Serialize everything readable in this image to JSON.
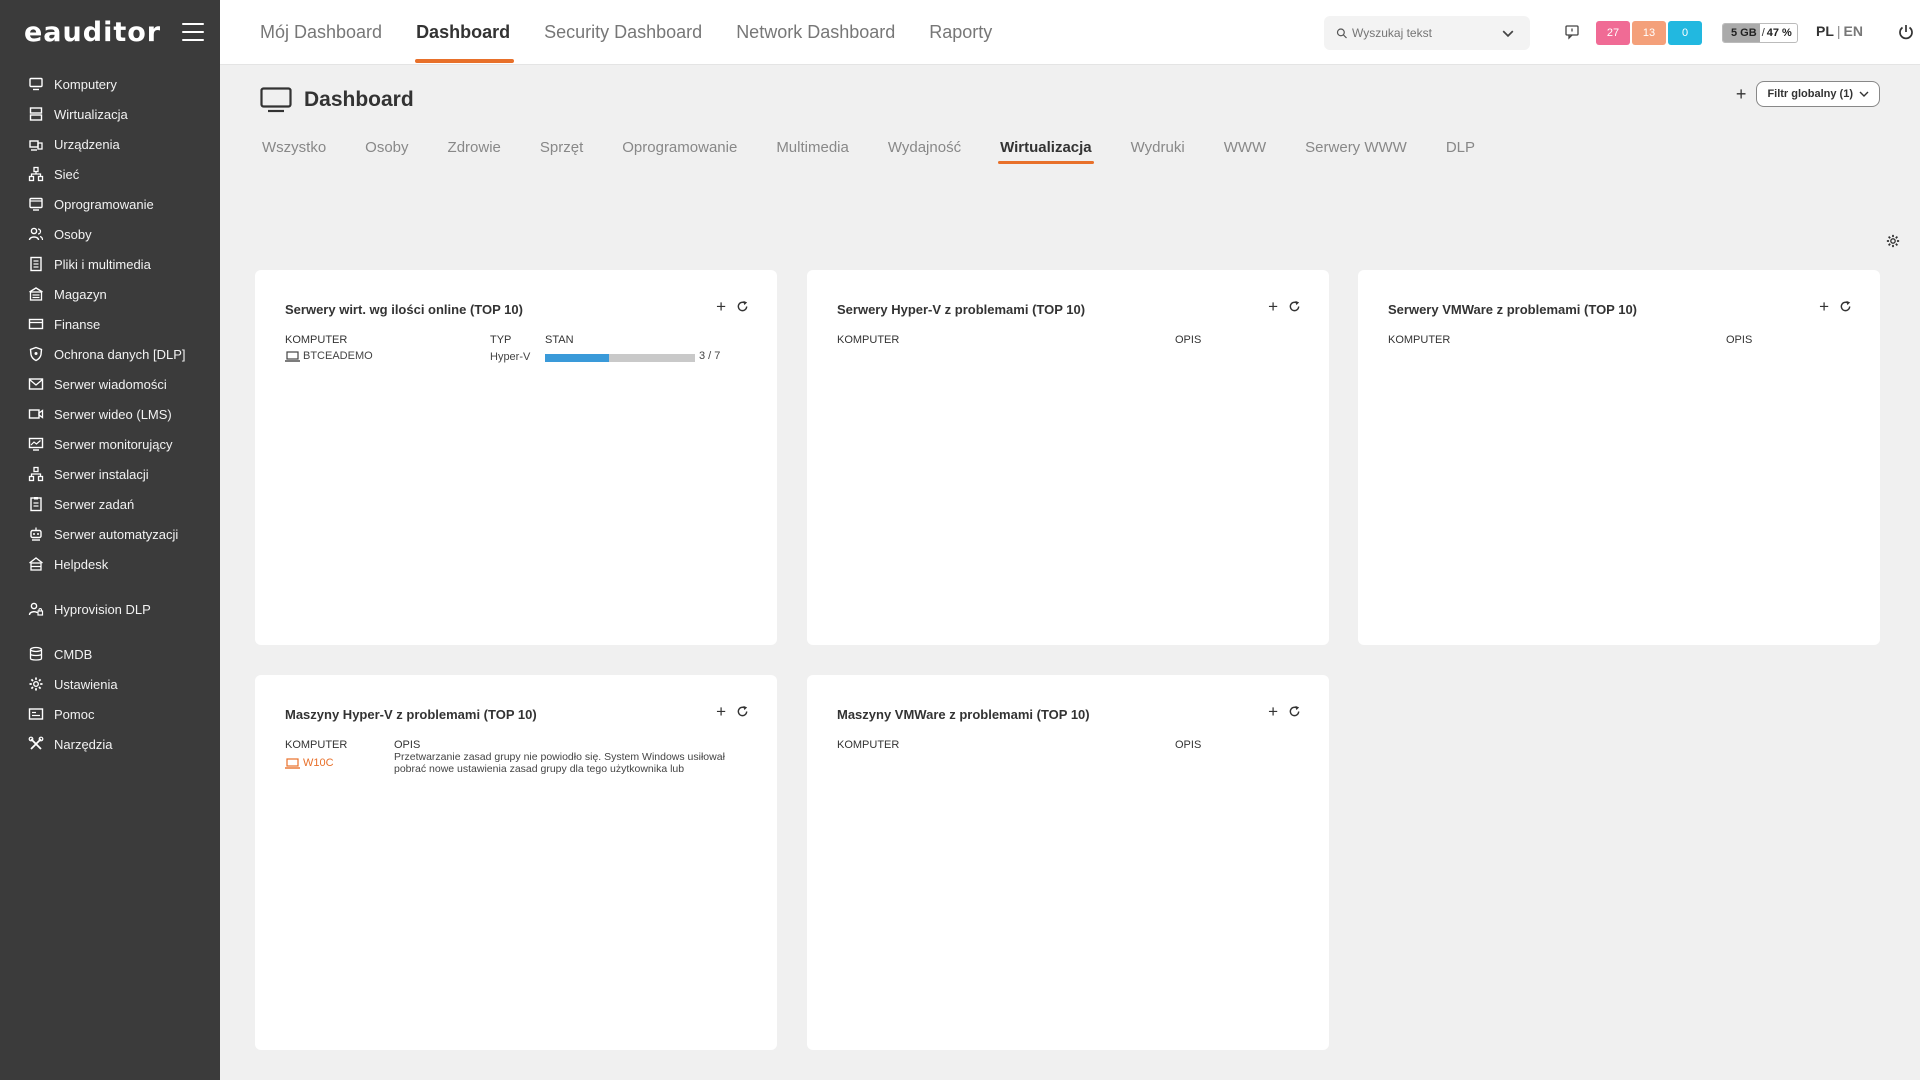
{
  "sidebar": {
    "logo": "eauditor",
    "items": [
      {
        "label": "Komputery",
        "icon": "monitor-icon"
      },
      {
        "label": "Wirtualizacja",
        "icon": "server-icon"
      },
      {
        "label": "Urządzenia",
        "icon": "devices-icon"
      },
      {
        "label": "Sieć",
        "icon": "network-icon"
      },
      {
        "label": "Oprogramowanie",
        "icon": "software-icon"
      },
      {
        "label": "Osoby",
        "icon": "users-icon"
      },
      {
        "label": "Pliki i multimedia",
        "icon": "file-icon"
      },
      {
        "label": "Magazyn",
        "icon": "warehouse-icon"
      },
      {
        "label": "Finanse",
        "icon": "wallet-icon"
      },
      {
        "label": "Ochrona danych [DLP]",
        "icon": "shield-icon"
      },
      {
        "label": "Serwer wiadomości",
        "icon": "mail-icon"
      },
      {
        "label": "Serwer wideo (LMS)",
        "icon": "video-icon"
      },
      {
        "label": "Serwer monitorujący",
        "icon": "chart-monitor-icon"
      },
      {
        "label": "Serwer instalacji",
        "icon": "install-icon"
      },
      {
        "label": "Serwer zadań",
        "icon": "tasks-icon"
      },
      {
        "label": "Serwer automatyzacji",
        "icon": "robot-icon"
      },
      {
        "label": "Helpdesk",
        "icon": "helpdesk-icon"
      }
    ],
    "items2": [
      {
        "label": "Hyprovision DLP",
        "icon": "user-key-icon"
      }
    ],
    "items3": [
      {
        "label": "CMDB",
        "icon": "database-icon"
      },
      {
        "label": "Ustawienia",
        "icon": "gear-icon"
      },
      {
        "label": "Pomoc",
        "icon": "help-icon"
      },
      {
        "label": "Narzędzia",
        "icon": "tools-icon"
      }
    ]
  },
  "topbar": {
    "tabs": [
      "Mój Dashboard",
      "Dashboard",
      "Security Dashboard",
      "Network Dashboard",
      "Raporty"
    ],
    "active_tab": 1,
    "search_placeholder": "Wyszukaj tekst",
    "badges": [
      "27",
      "13",
      "0"
    ],
    "memory": {
      "size": "5 GB",
      "sep": "/",
      "percent": "47 %",
      "fill_fraction": 0.47
    },
    "lang": {
      "pl": "PL",
      "sep": "|",
      "en": "EN"
    }
  },
  "page": {
    "title": "Dashboard",
    "filter_label": "Filtr globalny (1)",
    "plus": "+",
    "sub_tabs": [
      "Wszystko",
      "Osoby",
      "Zdrowie",
      "Sprzęt",
      "Oprogramowanie",
      "Multimedia",
      "Wydajność",
      "Wirtualizacja",
      "Wydruki",
      "WWW",
      "Serwery WWW",
      "DLP"
    ],
    "active_sub_tab": 7
  },
  "cards": {
    "c1": {
      "title": "Serwery wirt. wg ilości online (TOP 10)",
      "col_komputer": "KOMPUTER",
      "col_typ": "TYP",
      "col_stan": "STAN",
      "row": {
        "komputer": "BTCEADEMO",
        "typ": "Hyper-V",
        "online": 3,
        "total": 7,
        "stan_text": "3 / 7"
      }
    },
    "c2": {
      "title": "Serwery Hyper-V z problemami (TOP 10)",
      "col_komputer": "KOMPUTER",
      "col_opis": "OPIS"
    },
    "c3": {
      "title": "Serwery VMWare z problemami (TOP 10)",
      "col_komputer": "KOMPUTER",
      "col_opis": "OPIS"
    },
    "c4": {
      "title": "Maszyny Hyper-V z problemami (TOP 10)",
      "col_komputer": "KOMPUTER",
      "col_opis": "OPIS",
      "row": {
        "komputer": "W10C",
        "opis": "Przetwarzanie zasad grupy nie powiodło się. System Windows usiłował pobrać nowe ustawienia zasad grupy dla tego użytkownika lub"
      }
    },
    "c5": {
      "title": "Maszyny VMWare z problemami (TOP 10)",
      "col_komputer": "KOMPUTER",
      "col_opis": "OPIS"
    }
  },
  "colors": {
    "accent": "#e8702a",
    "sidebar_bg": "#3b3b3b",
    "progress": "#3a9ad9"
  }
}
